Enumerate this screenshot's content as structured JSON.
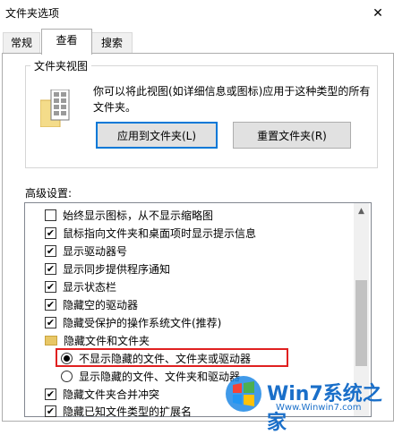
{
  "window": {
    "title": "文件夹选项",
    "close_glyph": "✕"
  },
  "tabs": [
    {
      "label": "常规"
    },
    {
      "label": "查看"
    },
    {
      "label": "搜索"
    }
  ],
  "folder_views": {
    "legend": "文件夹视图",
    "description": "你可以将此视图(如详细信息或图标)应用于这种类型的所有文件夹。",
    "apply_button": "应用到文件夹(L)",
    "reset_button": "重置文件夹(R)"
  },
  "advanced": {
    "label": "高级设置:",
    "items": [
      {
        "type": "checkbox",
        "checked": false,
        "label": "始终显示图标，从不显示缩略图"
      },
      {
        "type": "checkbox",
        "checked": true,
        "label": "鼠标指向文件夹和桌面项时显示提示信息"
      },
      {
        "type": "checkbox",
        "checked": true,
        "label": "显示驱动器号"
      },
      {
        "type": "checkbox",
        "checked": true,
        "label": "显示同步提供程序通知"
      },
      {
        "type": "checkbox",
        "checked": true,
        "label": "显示状态栏"
      },
      {
        "type": "checkbox",
        "checked": true,
        "label": "隐藏空的驱动器"
      },
      {
        "type": "checkbox",
        "checked": true,
        "label": "隐藏受保护的操作系统文件(推荐)"
      },
      {
        "type": "folder",
        "label": "隐藏文件和文件夹"
      },
      {
        "type": "radio",
        "checked": true,
        "label": "不显示隐藏的文件、文件夹或驱动器"
      },
      {
        "type": "radio",
        "checked": false,
        "label": "显示隐藏的文件、文件夹和驱动器"
      },
      {
        "type": "checkbox",
        "checked": true,
        "label": "隐藏文件夹合并冲突"
      },
      {
        "type": "checkbox",
        "checked": true,
        "label": "隐藏已知文件类型的扩展名"
      }
    ]
  },
  "watermark": {
    "brand": "Win7系统之家",
    "url": "Www.Winwin7.com"
  }
}
